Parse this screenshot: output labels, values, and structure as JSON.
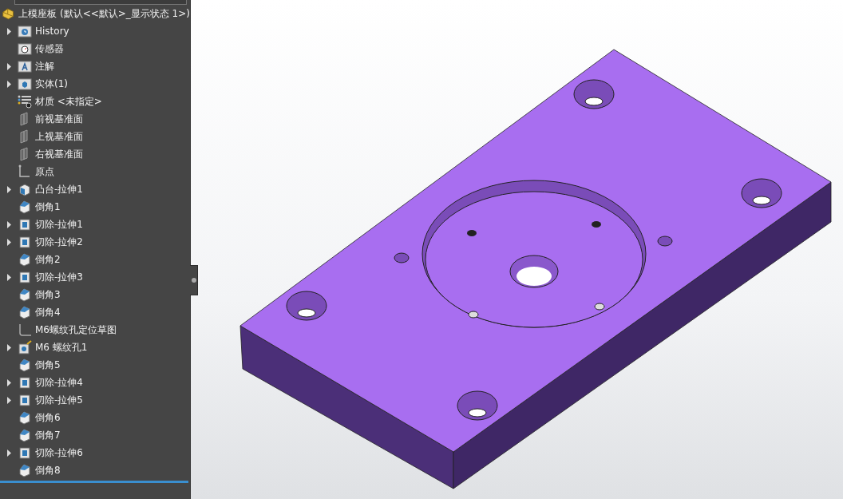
{
  "tree": {
    "root": {
      "label": "上模座板 (默认<<默认>_显示状态 1>)"
    },
    "items": [
      {
        "label": "History",
        "kind": "history",
        "expanded": false
      },
      {
        "label": "传感器",
        "kind": "sensor"
      },
      {
        "label": "注解",
        "kind": "annotation",
        "expanded": false
      },
      {
        "label": "实体(1)",
        "kind": "solid",
        "expanded": false
      },
      {
        "label": "材质 <未指定>",
        "kind": "material"
      },
      {
        "label": "前视基准面",
        "kind": "plane"
      },
      {
        "label": "上视基准面",
        "kind": "plane"
      },
      {
        "label": "右视基准面",
        "kind": "plane"
      },
      {
        "label": "原点",
        "kind": "origin"
      },
      {
        "label": "凸台-拉伸1",
        "kind": "boss",
        "expanded": false
      },
      {
        "label": "倒角1",
        "kind": "chamfer"
      },
      {
        "label": "切除-拉伸1",
        "kind": "cut",
        "expanded": false
      },
      {
        "label": "切除-拉伸2",
        "kind": "cut",
        "expanded": false
      },
      {
        "label": "倒角2",
        "kind": "chamfer"
      },
      {
        "label": "切除-拉伸3",
        "kind": "cut",
        "expanded": false
      },
      {
        "label": "倒角3",
        "kind": "chamfer"
      },
      {
        "label": "倒角4",
        "kind": "chamfer"
      },
      {
        "label": "M6螺纹孔定位草图",
        "kind": "sketch"
      },
      {
        "label": "M6 螺纹孔1",
        "kind": "hole",
        "expanded": false
      },
      {
        "label": "倒角5",
        "kind": "chamfer"
      },
      {
        "label": "切除-拉伸4",
        "kind": "cut",
        "expanded": false
      },
      {
        "label": "切除-拉伸5",
        "kind": "cut",
        "expanded": false
      },
      {
        "label": "倒角6",
        "kind": "chamfer"
      },
      {
        "label": "倒角7",
        "kind": "chamfer"
      },
      {
        "label": "切除-拉伸6",
        "kind": "cut",
        "expanded": false
      },
      {
        "label": "倒角8",
        "kind": "chamfer"
      }
    ]
  }
}
